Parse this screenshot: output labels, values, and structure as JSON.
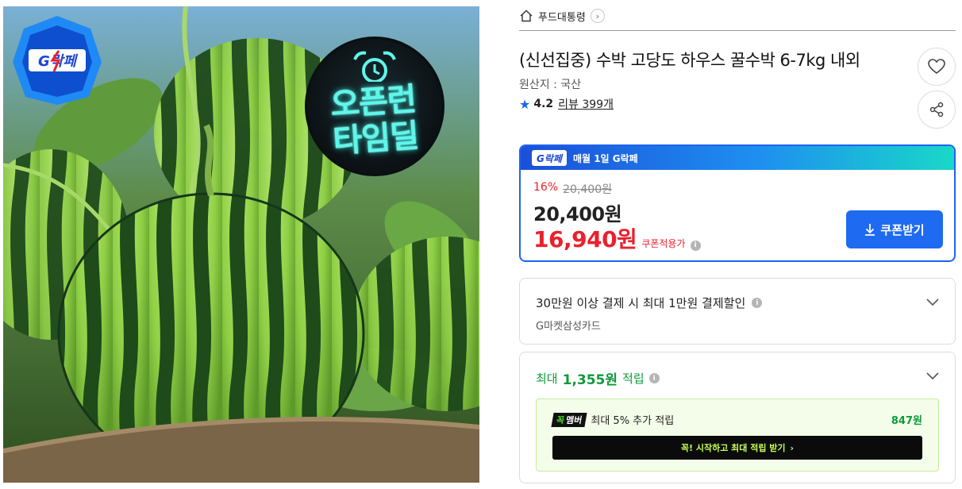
{
  "image": {
    "badge_text": "G락페",
    "timedeal_line1": "오픈런",
    "timedeal_line2": "타임딜",
    "icons": [
      "g-lakpe-badge-icon",
      "alarm-clock-icon"
    ]
  },
  "breadcrumb": {
    "store": "푸드대통령"
  },
  "product": {
    "title": "(신선집중) 수박 고당도 하우스 꿀수박 6-7kg 내외",
    "origin": "원산지 : 국산",
    "rating": "4.2",
    "review_link": "리뷰 399개"
  },
  "price_box": {
    "badge": "G락페",
    "headline": "매월 1일 G락페",
    "discount_rate": "16%",
    "original_price": "20,400원",
    "base_price": "20,400원",
    "coupon_price": "16,940원",
    "coupon_note": "쿠폰적용가",
    "coupon_button": "쿠폰받기",
    "accent_color": "#1e64f2",
    "sale_color": "#e9212c"
  },
  "card_discount": {
    "headline": "30만원 이상 결제 시 최대 1만원 결제할인",
    "card_name": "G마켓삼성카드"
  },
  "points": {
    "prefix": "최대",
    "amount": "1,355원",
    "suffix": "적립",
    "member_badge_left": "꼭",
    "member_badge_right": "멤버",
    "member_text": "최대 5% 추가 적립",
    "member_amount": "847원",
    "cta": "꼭! 시작하고 최대 적립 받기",
    "color": "#0e9a3a"
  }
}
